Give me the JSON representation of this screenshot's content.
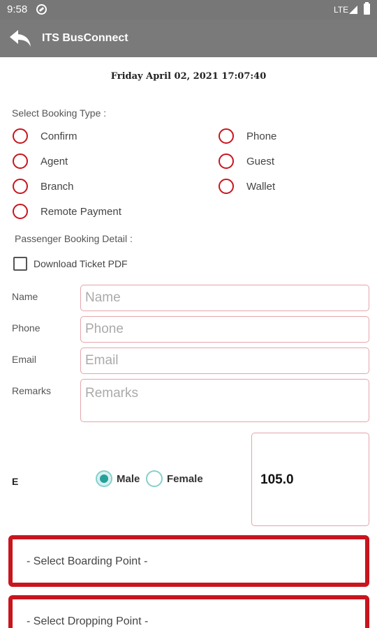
{
  "status_bar": {
    "time": "9:58",
    "network": "LTE"
  },
  "toolbar": {
    "title": "ITS BusConnect",
    "back_icon": "back-arrow-icon"
  },
  "datetime": "Friday April 02, 2021 17:07:40",
  "booking_type": {
    "label": "Select Booking Type :",
    "options": [
      "Confirm",
      "Phone",
      "Agent",
      "Guest",
      "Branch",
      "Wallet",
      "Remote Payment"
    ]
  },
  "passenger": {
    "label": "Passenger Booking Detail :",
    "download_pdf_label": "Download Ticket PDF",
    "fields": {
      "name": {
        "label": "Name",
        "placeholder": "Name",
        "value": ""
      },
      "phone": {
        "label": "Phone",
        "placeholder": "Phone",
        "value": ""
      },
      "email": {
        "label": "Email",
        "placeholder": "Email",
        "value": ""
      },
      "remarks": {
        "label": "Remarks",
        "placeholder": "Remarks",
        "value": ""
      }
    }
  },
  "gender": {
    "prefix": "E",
    "options": [
      "Male",
      "Female"
    ],
    "selected": "Male"
  },
  "fare": "105.0",
  "boarding_point": "- Select Boarding Point -",
  "dropping_point": "- Select Dropping Point -",
  "colors": {
    "accent": "#c8151e",
    "toolbar": "#7a7a7a",
    "radio_checked": "#24a09a"
  }
}
